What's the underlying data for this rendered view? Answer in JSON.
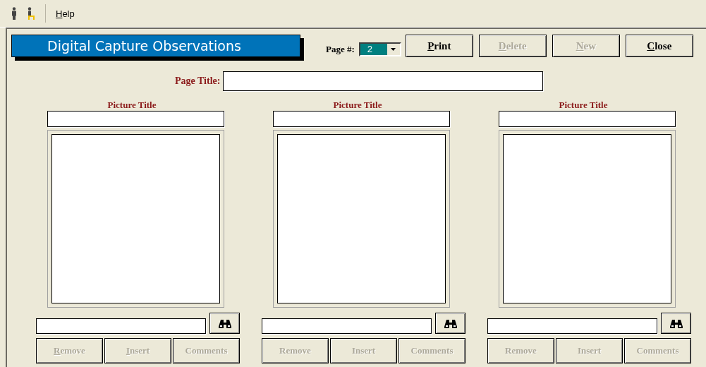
{
  "menu": {
    "items": [
      {
        "label": "Help",
        "mnemonic": true
      }
    ]
  },
  "header": {
    "title": "Digital Capture Observations"
  },
  "page_number": {
    "label": "Page #:",
    "value": "2"
  },
  "buttons": [
    {
      "label": "Print",
      "mnemonic": true,
      "disabled": false
    },
    {
      "label": "Delete",
      "mnemonic": true,
      "disabled": true
    },
    {
      "label": "New",
      "mnemonic": true,
      "disabled": true
    },
    {
      "label": "Close",
      "mnemonic": true,
      "disabled": false
    }
  ],
  "page_title": {
    "label": "Page Title:"
  },
  "pictures": [
    {
      "title_label": "Picture Title",
      "buttons": [
        {
          "label": "Remove",
          "mnemonic": true,
          "disabled": true
        },
        {
          "label": "Insert",
          "mnemonic": true,
          "disabled": true
        },
        {
          "label": "Comments",
          "mnemonic": false,
          "disabled": true
        }
      ]
    },
    {
      "title_label": "Picture Title",
      "buttons": [
        {
          "label": "Remove",
          "mnemonic": false,
          "disabled": true
        },
        {
          "label": "Insert",
          "mnemonic": false,
          "disabled": true
        },
        {
          "label": "Comments",
          "mnemonic": false,
          "disabled": true
        }
      ]
    },
    {
      "title_label": "Picture Title",
      "buttons": [
        {
          "label": "Remove",
          "mnemonic": false,
          "disabled": true
        },
        {
          "label": "Insert",
          "mnemonic": false,
          "disabled": true
        },
        {
          "label": "Comments",
          "mnemonic": false,
          "disabled": true
        }
      ]
    }
  ]
}
